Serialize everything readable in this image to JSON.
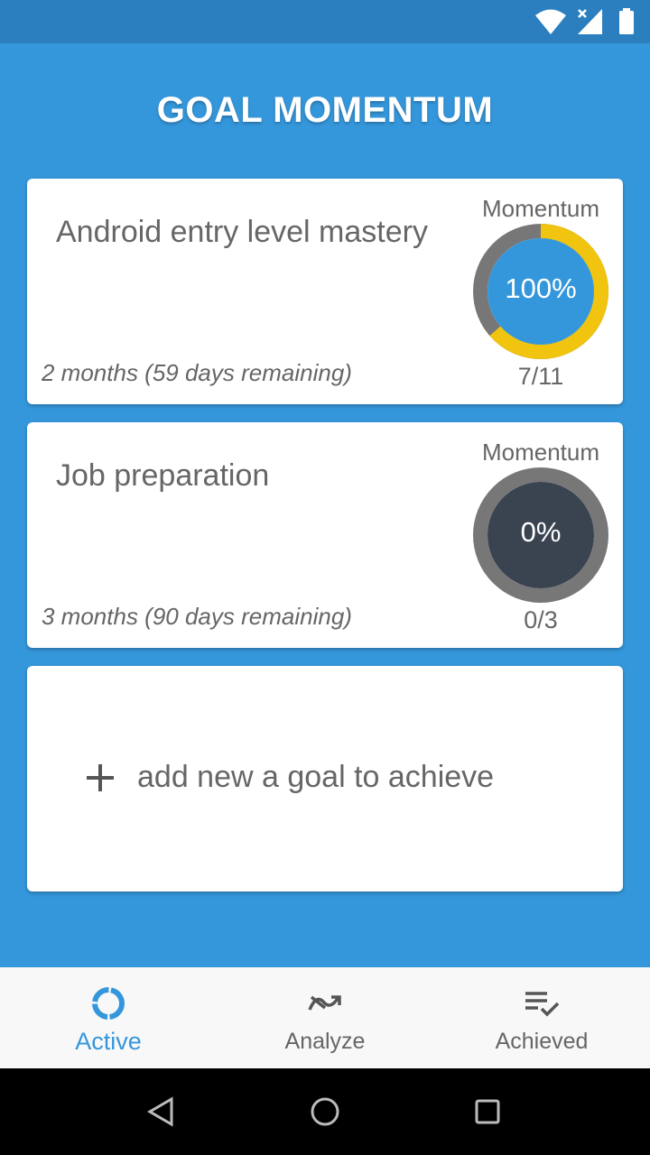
{
  "status_bar": {
    "icons": [
      "wifi-icon",
      "signal-no-data-icon",
      "battery-icon"
    ]
  },
  "app": {
    "title": "GOAL MOMENTUM"
  },
  "goals": [
    {
      "name": "Android entry level mastery",
      "duration": "2 months (59 days remaining)",
      "momentum_label": "Momentum",
      "momentum_percent": "100%",
      "progress": "7/11",
      "progress_fraction": 0.636,
      "ring_color": "#f1c40f",
      "inner_color": "#3597db"
    },
    {
      "name": "Job preparation",
      "duration": "3 months (90 days remaining)",
      "momentum_label": "Momentum",
      "momentum_percent": "0%",
      "progress": "0/3",
      "progress_fraction": 0,
      "ring_color": "#f1c40f",
      "inner_color": "#3a4350"
    }
  ],
  "add_goal": {
    "icon": "plus-icon",
    "label": "add new a goal to achieve"
  },
  "bottom_nav": {
    "items": [
      {
        "label": "Active",
        "icon": "progress-ring-icon",
        "active": true
      },
      {
        "label": "Analyze",
        "icon": "trend-icon",
        "active": false
      },
      {
        "label": "Achieved",
        "icon": "checklist-icon",
        "active": false
      }
    ]
  },
  "system_nav": {
    "icons": [
      "back-icon",
      "home-icon",
      "recents-icon"
    ]
  },
  "colors": {
    "primary": "#3597db",
    "status_bar": "#2b7fbe",
    "ring_track": "#777777",
    "ring_progress": "#f1c40f",
    "card": "#ffffff",
    "text": "#666666"
  }
}
